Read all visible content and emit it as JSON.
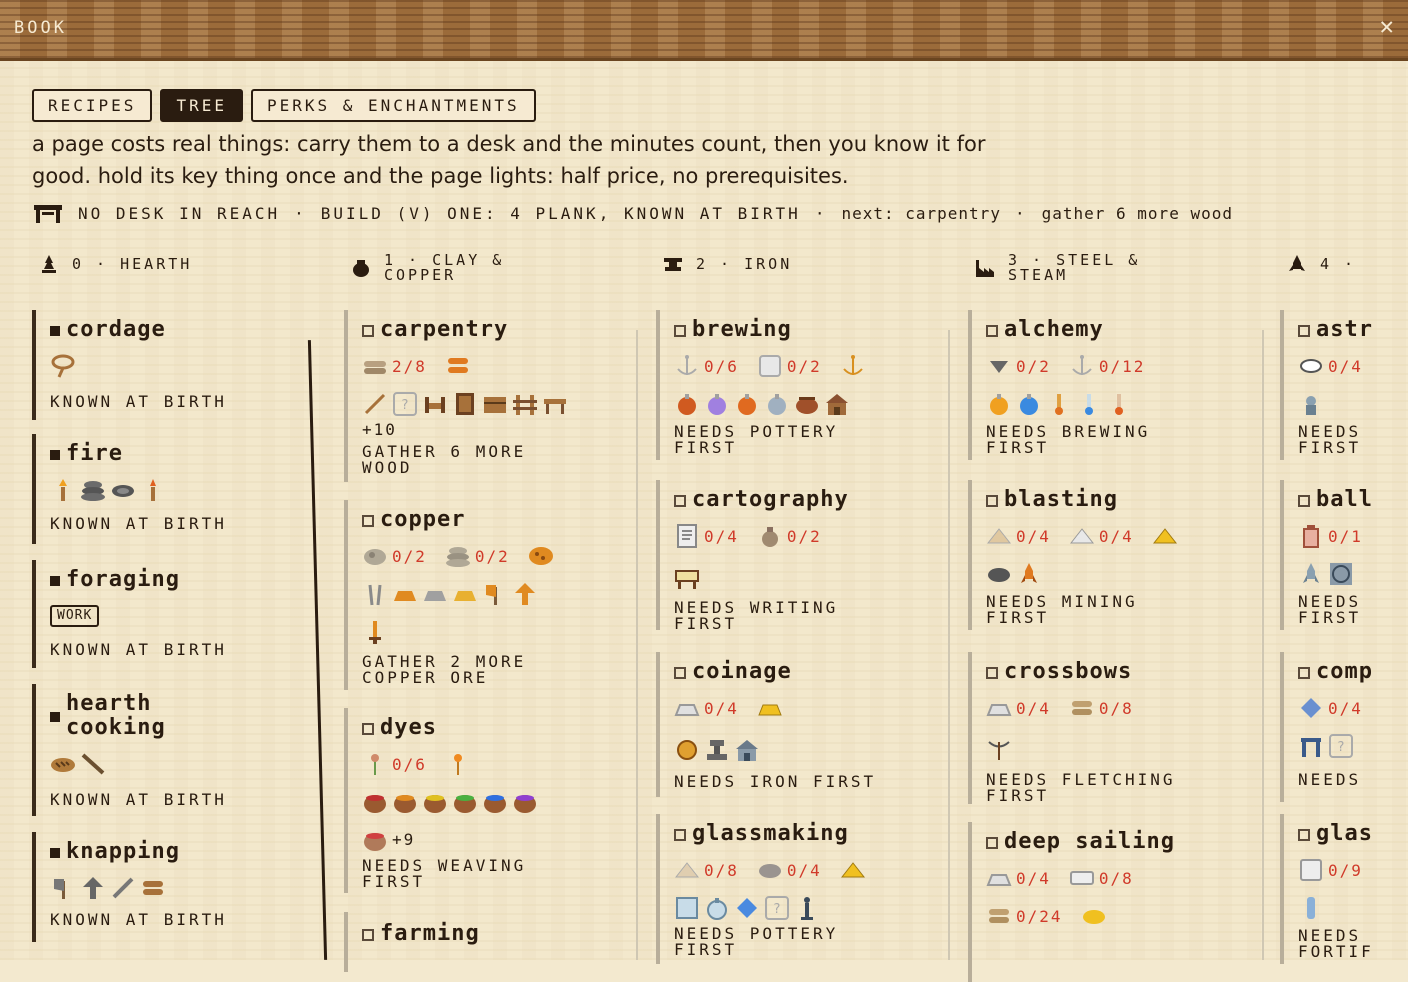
{
  "window": {
    "title": "BOOK",
    "close": "✕"
  },
  "tabs": [
    {
      "label": "RECIPES",
      "active": false
    },
    {
      "label": "TREE",
      "active": true
    },
    {
      "label": "PERKS & ENCHANTMENTS",
      "active": false
    }
  ],
  "description": "a page costs real things: carry them to a desk and the minutes count, then you know it for good. hold its key thing once and the page lights: half price, no prerequisites.",
  "status": {
    "icon": "desk-icon",
    "desk": "NO DESK IN REACH",
    "sep1": "·",
    "build": "BUILD (V) ONE: 4 PLANK, KNOWN AT BIRTH",
    "sep2": "·",
    "next": "next: carpentry",
    "sep3": "·",
    "gather": "gather 6 more wood"
  },
  "columns": [
    {
      "icon": "flame-icon",
      "line1": "0 · HEARTH",
      "line2": ""
    },
    {
      "icon": "pot-icon",
      "line1": "1 · CLAY &",
      "line2": "COPPER"
    },
    {
      "icon": "anvil-icon",
      "line1": "2 · IRON",
      "line2": ""
    },
    {
      "icon": "factory-icon",
      "line1": "3 · STEEL &",
      "line2": "STEAM"
    },
    {
      "icon": "rocket-icon",
      "line1": "4 ·",
      "line2": ""
    }
  ],
  "cards": {
    "cordage": {
      "name": "cordage",
      "note": "KNOWN AT BIRTH"
    },
    "fire": {
      "name": "fire",
      "note": "KNOWN AT BIRTH"
    },
    "foraging": {
      "name": "foraging",
      "badge": "WORK",
      "note": "KNOWN AT BIRTH"
    },
    "hearth": {
      "name1": "hearth",
      "name2": "cooking",
      "note": "KNOWN AT BIRTH"
    },
    "knapping": {
      "name": "knapping",
      "note": "KNOWN AT BIRTH"
    },
    "carpentry": {
      "name": "carpentry",
      "req1": "2/8",
      "extra": "+10",
      "note1": "GATHER 6 MORE",
      "note2": "WOOD"
    },
    "copper": {
      "name": "copper",
      "req1": "0/2",
      "req2": "0/2",
      "note1": "GATHER 2 MORE",
      "note2": "COPPER ORE"
    },
    "dyes": {
      "name": "dyes",
      "req1": "0/6",
      "extra": "+9",
      "note1": "NEEDS WEAVING",
      "note2": "FIRST"
    },
    "farming": {
      "name": "farming"
    },
    "brewing": {
      "name": "brewing",
      "req1": "0/6",
      "req2": "0/2",
      "note1": "NEEDS POTTERY",
      "note2": "FIRST"
    },
    "cartography": {
      "name": "cartography",
      "req1": "0/4",
      "req2": "0/2",
      "note1": "NEEDS WRITING",
      "note2": "FIRST"
    },
    "coinage": {
      "name": "coinage",
      "req1": "0/4",
      "note1": "NEEDS IRON FIRST"
    },
    "glassmaking": {
      "name": "glassmaking",
      "req1": "0/8",
      "req2": "0/4",
      "note1": "NEEDS POTTERY",
      "note2": "FIRST"
    },
    "alchemy": {
      "name": "alchemy",
      "req1": "0/2",
      "req2": "0/12",
      "note1": "NEEDS BREWING",
      "note2": "FIRST"
    },
    "blasting": {
      "name": "blasting",
      "req1": "0/4",
      "req2": "0/4",
      "note1": "NEEDS MINING",
      "note2": "FIRST"
    },
    "crossbows": {
      "name": "crossbows",
      "req1": "0/4",
      "req2": "0/8",
      "note1": "NEEDS FLETCHING",
      "note2": "FIRST"
    },
    "deepsailing": {
      "name": "deep sailing",
      "req1": "0/4",
      "req2": "0/8",
      "req3": "0/24"
    },
    "astr": {
      "name": "astr",
      "req1": "0/4",
      "note1": "NEEDS",
      "note2": "FIRST"
    },
    "ball": {
      "name": "ball",
      "req1": "0/1",
      "note1": "NEEDS",
      "note2": "FIRST"
    },
    "comp": {
      "name": "comp",
      "req1": "0/4",
      "note1": "NEEDS"
    },
    "glas": {
      "name": "glas",
      "req1": "0/9",
      "note1": "NEEDS",
      "note2": "FORTIF"
    }
  },
  "colors": {
    "bar": "#9b6b3a",
    "paper": "#f3e8cc",
    "ink": "#2a1c10",
    "red": "#d03a2a",
    "orange": "#e08a2a"
  }
}
